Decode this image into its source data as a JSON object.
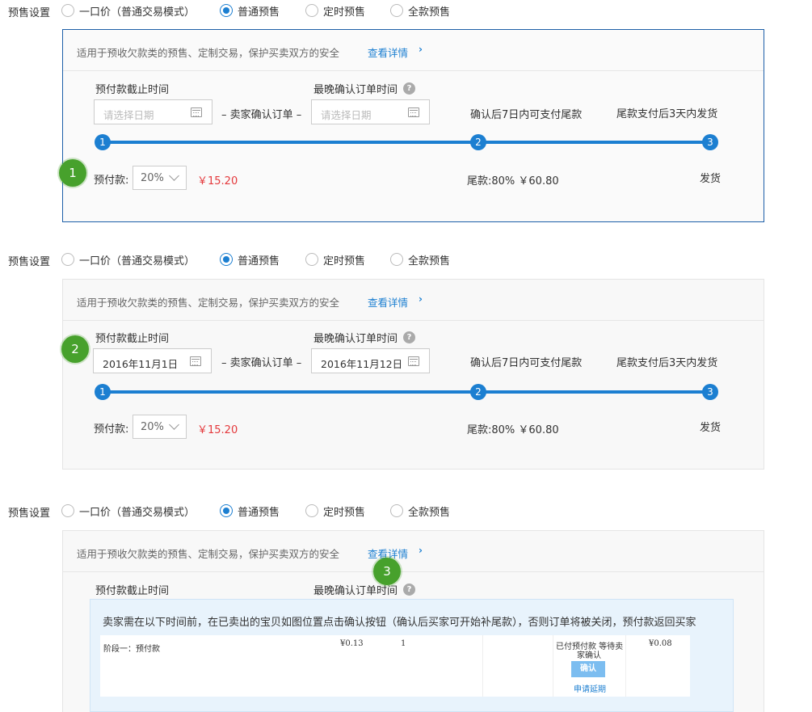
{
  "radio_row": {
    "label": "预售设置",
    "options": [
      "一口价（普通交易模式）",
      "普通预售",
      "定时预售",
      "全款预售"
    ],
    "selected": "普通预售"
  },
  "panel": {
    "header_text": "适用于预收欠款类的预售、定制交易，保护买卖双方的安全",
    "header_link": "查看详情",
    "header_chevron": "›",
    "deadline_label": "预付款截止时间",
    "confirm_label": "最晚确认订单时间",
    "help_glyph": "?",
    "seller_confirm": "– 卖家确认订单 –",
    "date_placeholder": "请选择日期",
    "step2_text": "确认后7日内可支付尾款",
    "step3_text": "尾款支付后3天内发货",
    "steps": [
      "1",
      "2",
      "3"
    ],
    "prepay_label": "预付款:",
    "prepay_percent": "20%",
    "prepay_price": "￥15.20",
    "balance": "尾款:80%  ￥60.80",
    "ship": "发货"
  },
  "section2_dates": {
    "start": "2016年11月1日",
    "end": "2016年11月12日"
  },
  "markers": [
    "1",
    "2",
    "3"
  ],
  "tip": {
    "text": "卖家需在以下时间前，在已卖出的宝贝如图位置点击确认按钮（确认后买家可开始补尾款），否则订单将被关闭，预付款返回买家",
    "row_stage": "阶段一：预付款",
    "row_price": "¥0.13",
    "row_qty": "1",
    "row_status_1": "已付预付款 等待卖",
    "row_status_2": "家确认",
    "row_button": "确认",
    "row_link": "申请延期",
    "row_amount": "¥0.08"
  },
  "colors": {
    "accent": "#1c7fd1",
    "marker": "#47a12c",
    "price": "#e4393c",
    "active_border": "#1d5fa8"
  }
}
